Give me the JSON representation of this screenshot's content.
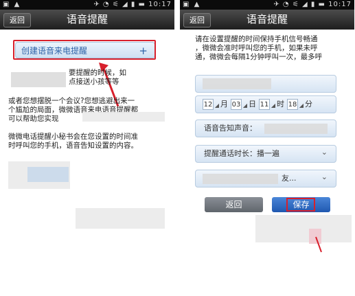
{
  "status_bar": {
    "left_icons": "▣ ▲",
    "right_icons": "✈ ◔ ⚟ ◢ ▮ ▬",
    "time": "10:17"
  },
  "screen1": {
    "back_label": "返回",
    "title": "语音提醒",
    "create_button_label": "创建语音来电提醒",
    "plus_icon": "+",
    "para1": "要提醒的时候，如\n点接送小孩等等",
    "para2": "或者您想摆脱一个会议?您想逃避出来一\n个尴尬的局面，微微语音来电语音提醒都\n可以帮助您实现",
    "para3": "微微电话提醒小秘书会在您设置的时间准\n时呼叫您的手机，语音告知设置的内容。",
    "highlight_color": "#d8202c"
  },
  "screen2": {
    "back_label": "返回",
    "title": "语音提醒",
    "intro": "请在设置提醒的时间保持手机信号畅通\n，微微会准时呼叫您的手机，如果未呼\n通，微微会每隔1分钟呼叫一次，最多呼",
    "date": {
      "month": "12",
      "month_unit": "月",
      "day": "03",
      "day_unit": "日",
      "hour": "11",
      "hour_unit": "时",
      "minute": "18",
      "minute_unit": "分"
    },
    "sound_label": "语音告知声音：",
    "duration_label": "提醒通话时长：播一遍",
    "contact_label": "友...",
    "back_button": "返回",
    "save_button": "保存"
  },
  "colors": {
    "accent": "#2e63a8",
    "highlight": "#d8202c",
    "titlebar": "#2a2a2a"
  }
}
